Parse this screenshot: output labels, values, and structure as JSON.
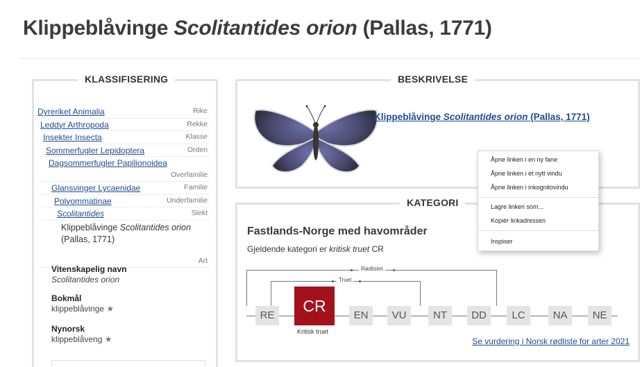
{
  "page": {
    "title_common": "Klippeblåvinge",
    "title_scientific": "Scolitantides orion",
    "title_author": "(Pallas, 1771)"
  },
  "classification": {
    "heading": "KLASSIFISERING",
    "rows": [
      {
        "name": "Dyreriket Animalia",
        "rank": "Rike"
      },
      {
        "name": "Leddyr Arthropoda",
        "rank": "Rekke"
      },
      {
        "name": "Insekter Insecta",
        "rank": "Klasse"
      },
      {
        "name": "Sommerfugler Lepidoptera",
        "rank": "Orden"
      },
      {
        "name": "Dagsommerfugler Papilionoidea",
        "rank": "Overfamilie"
      },
      {
        "name": "Glansvinger Lycaenidae",
        "rank": "Familie"
      },
      {
        "name": "Polyommatinae",
        "rank": "Underfamilie"
      },
      {
        "name": "Scolitantides",
        "rank": "Slekt"
      }
    ],
    "species": {
      "common": "Klippeblåvinge",
      "scientific": "Scolitantides orion",
      "author": "(Pallas, 1771)",
      "rank": "Art"
    },
    "names": {
      "scientific_label": "Vitenskapelig navn",
      "scientific_value": "Scolitantides orion",
      "bokmal_label": "Bokmål",
      "bokmal_value": "klippeblåvinge",
      "nynorsk_label": "Nynorsk",
      "nynorsk_value": "klippeblåveng",
      "star": "★"
    }
  },
  "description": {
    "heading": "BESKRIVELSE",
    "link_common": "Klippeblåvinge",
    "link_scientific": "Scolitantides orion",
    "link_author": "(Pallas, 1771)"
  },
  "category": {
    "heading": "KATEGORI",
    "region": "Fastlands-Norge med havområder",
    "subtitle_prefix": "Gjeldende kategori er",
    "subtitle_category": "kritisk truet",
    "subtitle_code": "CR",
    "scale": [
      "RE",
      "CR",
      "EN",
      "VU",
      "NT",
      "DD",
      "LC",
      "NA",
      "NE"
    ],
    "active": "CR",
    "active_label": "Kritisk truet",
    "bracket_redlisted": "Rødlistet",
    "bracket_threatened": "Truet",
    "assessment_link": "Se vurdering i Norsk rødliste for arter 2021",
    "active_color": "#a3121b"
  },
  "context_menu": {
    "items": [
      "Åpne linken i en ny fane",
      "Åpne linken i et nytt vindu",
      "Åpne linken i inkognitovindu",
      "Lagre linken som...",
      "Kopiér linkadressen",
      "Inspiser"
    ]
  }
}
